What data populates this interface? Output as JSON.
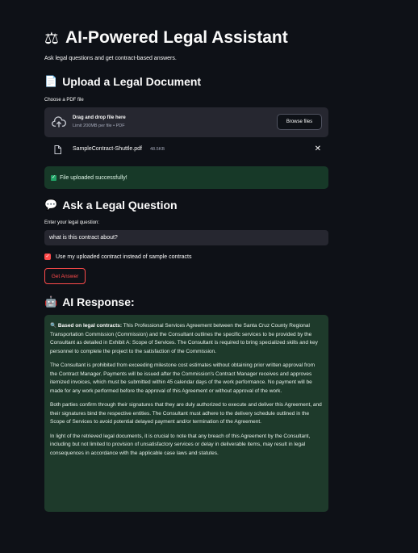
{
  "header": {
    "icon": "scales-icon",
    "title": "AI-Powered Legal Assistant",
    "subtitle": "Ask legal questions and get contract-based answers."
  },
  "upload": {
    "heading_icon": "document-icon",
    "heading": "Upload a Legal Document",
    "label": "Choose a PDF file",
    "drop_text": "Drag and drop file here",
    "limit_text": "Limit 200MB per file • PDF",
    "browse_label": "Browse files",
    "file_name": "SampleContract-Shuttle.pdf",
    "file_size": "48.5KB",
    "success_message": "File uploaded successfully!"
  },
  "question": {
    "heading_icon": "speech-bubble-icon",
    "heading": "Ask a Legal Question",
    "label": "Enter your legal question:",
    "value": "what is this contract about?",
    "checkbox_label": "Use my uploaded contract instead of sample contracts",
    "checkbox_checked": true,
    "button_label": "Get Answer"
  },
  "response": {
    "heading_icon": "robot-icon",
    "heading": "AI Response:",
    "lead_icon": "magnifier-icon",
    "lead_bold": "Based on legal contracts:",
    "p1": " This Professional Services Agreement between the Santa Cruz County Regional Transportation Commission (Commission) and the Consultant outlines the specific services to be provided by the Consultant as detailed in Exhibit A: Scope of Services. The Consultant is required to bring specialized skills and key personnel to complete the project to the satisfaction of the Commission.",
    "p2": "The Consultant is prohibited from exceeding milestone cost estimates without obtaining prior written approval from the Contract Manager. Payments will be issued after the Commission's Contract Manager receives and approves itemized invoices, which must be submitted within 45 calendar days of the work performance. No payment will be made for any work performed before the approval of this Agreement or without approval of the work.",
    "p3": "Both parties confirm through their signatures that they are duly authorized to execute and deliver this Agreement, and their signatures bind the respective entities. The Consultant must adhere to the delivery schedule outlined in the Scope of Services to avoid potential delayed payment and/or termination of the Agreement.",
    "p4": "In light of the retrieved legal documents, it is crucial to note that any breach of this Agreement by the Consultant, including but not limited to provision of unsatisfactory services or delay in deliverable items, may result in legal consequences in accordance with the applicable case laws and statutes."
  },
  "colors": {
    "background": "#0e1117",
    "accent": "#ff4b4b",
    "success_bg": "#173928",
    "response_bg": "#1e3a2b"
  }
}
